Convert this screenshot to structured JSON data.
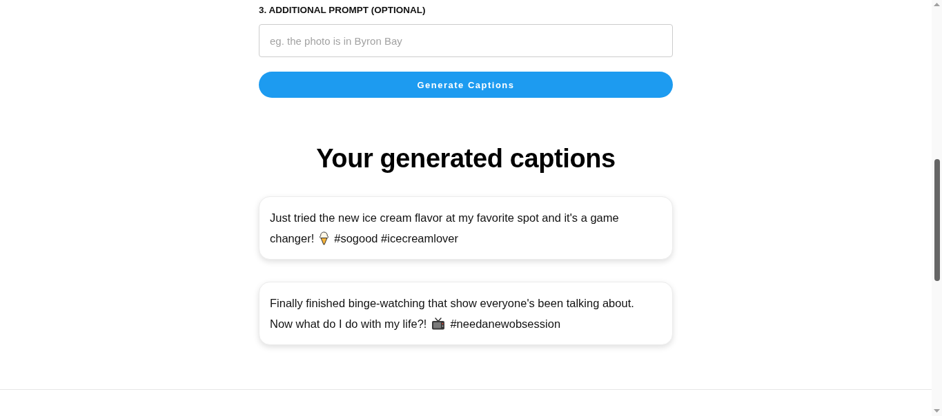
{
  "form": {
    "prompt_label": "3. ADDITIONAL PROMPT (OPTIONAL)",
    "prompt_field": {
      "placeholder": "eg. the photo is in Byron Bay"
    },
    "generate_button": "Generate Captions"
  },
  "results": {
    "heading": "Your generated captions",
    "captions": [
      {
        "kind": "ice-cream",
        "text_lines": [
          "Just tried the new ice cream flavor at my favorite spot and it's a game",
          "changer!"
        ],
        "hashtags": "#sogood #icecreamlover"
      },
      {
        "kind": "television",
        "text_lines": [
          "Finally finished binge-watching that show everyone's been talking about.",
          "Now what do I do with my life?!"
        ],
        "hashtags": "#needanewobsession"
      }
    ]
  }
}
